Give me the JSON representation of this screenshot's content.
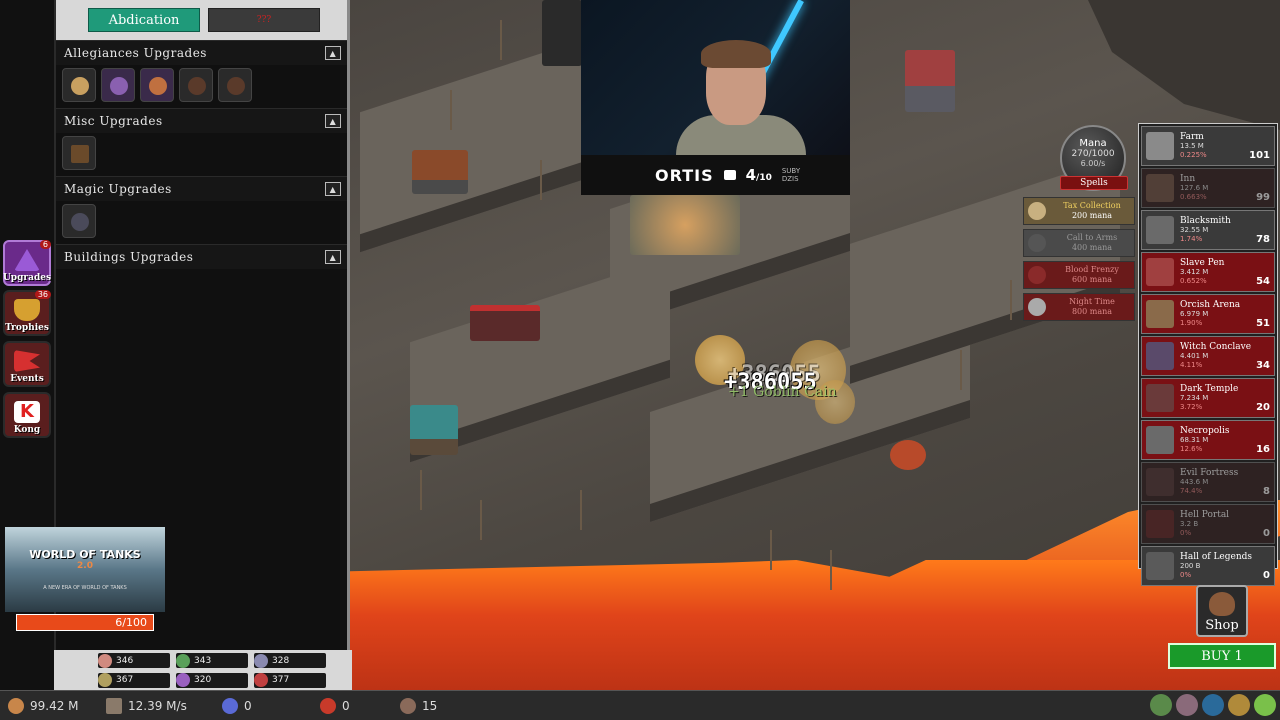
{
  "panel": {
    "abdication_label": "Abdication",
    "disabled_tab_label": "???",
    "sections": [
      {
        "title": "Allegiances Upgrades",
        "collapse": "▲",
        "icons": [
          "#c8a060",
          "#8a60b0",
          "#c07040",
          "#5a3a2a",
          "#5a3a2a"
        ]
      },
      {
        "title": "Misc Upgrades",
        "collapse": "▲",
        "icons": [
          "#6a4a2a"
        ]
      },
      {
        "title": "Magic Upgrades",
        "collapse": "▲",
        "icons": [
          "#4a4a5a"
        ]
      },
      {
        "title": "Buildings Upgrades",
        "collapse": "▲",
        "icons": []
      }
    ]
  },
  "rail": [
    {
      "label": "Upgrades",
      "badge": "6",
      "color": "#9a5ad6",
      "active": true
    },
    {
      "label": "Trophies",
      "badge": "36",
      "color": "#d6a030",
      "active": false
    },
    {
      "label": "Events",
      "badge": "",
      "color": "#d63030",
      "active": false
    },
    {
      "label": "Kong",
      "badge": "",
      "color": "#e02020",
      "active": false
    }
  ],
  "ad": {
    "title": "WORLD OF TANKS",
    "sub": "2.0",
    "tagline": "A NEW ERA OF WORLD OF TANKS",
    "progress": "6/100"
  },
  "allegiance_stats": [
    {
      "value": "346",
      "color": "#d08a80"
    },
    {
      "value": "343",
      "color": "#5aa05a"
    },
    {
      "value": "328",
      "color": "#8a8ab0"
    },
    {
      "value": "367",
      "color": "#b0a060"
    },
    {
      "value": "320",
      "color": "#9a60c0"
    },
    {
      "value": "377",
      "color": "#c04040"
    }
  ],
  "resources": {
    "gold": "99.42 M",
    "gold_rate": "12.39 M/s",
    "gems": "0",
    "rubies": "0",
    "population": "15"
  },
  "webcam": {
    "name": "ORTIS",
    "rank": "4",
    "rank_of": "/10",
    "tag_line1": "SUBY",
    "tag_line2": "DZIS"
  },
  "mana": {
    "title": "Mana",
    "value": "270/1000",
    "rate": "6.00/s",
    "spells_label": "Spells"
  },
  "spells": [
    {
      "name": "Tax Collection",
      "cost": "200 mana",
      "bg": "#6a5a3a",
      "fg": "#f0d060"
    },
    {
      "name": "Call to Arms",
      "cost": "400 mana",
      "bg": "#4a4a4a",
      "fg": "#999"
    },
    {
      "name": "Blood Frenzy",
      "cost": "600 mana",
      "bg": "#6a1a1a",
      "fg": "#d88"
    },
    {
      "name": "Night Time",
      "cost": "800 mana",
      "bg": "#6a1a1a",
      "fg": "#d88"
    }
  ],
  "buildings": [
    {
      "name": "Farm",
      "value": "13.5 M",
      "pct": "0.225%",
      "count": "101",
      "style": "gray",
      "color": "#8a8a8a"
    },
    {
      "name": "Inn",
      "value": "127.6 M",
      "pct": "0.663%",
      "count": "99",
      "style": "dim",
      "color": "#7a5a4a"
    },
    {
      "name": "Blacksmith",
      "value": "32.55 M",
      "pct": "1.74%",
      "count": "78",
      "style": "gray",
      "color": "#6a6a6a"
    },
    {
      "name": "Slave Pen",
      "value": "3.412 M",
      "pct": "0.652%",
      "count": "54",
      "style": "red",
      "color": "#a04040"
    },
    {
      "name": "Orcish Arena",
      "value": "6.979 M",
      "pct": "1.90%",
      "count": "51",
      "style": "red",
      "color": "#8a6a4a"
    },
    {
      "name": "Witch Conclave",
      "value": "4.401 M",
      "pct": "4.11%",
      "count": "34",
      "style": "red",
      "color": "#5a4a6a"
    },
    {
      "name": "Dark Temple",
      "value": "7.234 M",
      "pct": "3.72%",
      "count": "20",
      "style": "red",
      "color": "#6a3a3a"
    },
    {
      "name": "Necropolis",
      "value": "68.31 M",
      "pct": "12.6%",
      "count": "16",
      "style": "red",
      "color": "#6a6a6a"
    },
    {
      "name": "Evil Fortress",
      "value": "443.6 M",
      "pct": "74.4%",
      "count": "8",
      "style": "dim",
      "color": "#5a3a3a"
    },
    {
      "name": "Hell Portal",
      "value": "3.2 B",
      "pct": "0%",
      "count": "0",
      "style": "dim",
      "color": "#6a2a2a"
    },
    {
      "name": "Hall of Legends",
      "value": "200 B",
      "pct": "0%",
      "count": "0",
      "style": "gray",
      "color": "#5a5a5a"
    }
  ],
  "shop_label": "Shop",
  "buy_label": "BUY 1",
  "map": {
    "float_value": "+386055",
    "float_value_ghost": "+386055",
    "float_gold": "+1 Goblin Cain"
  }
}
